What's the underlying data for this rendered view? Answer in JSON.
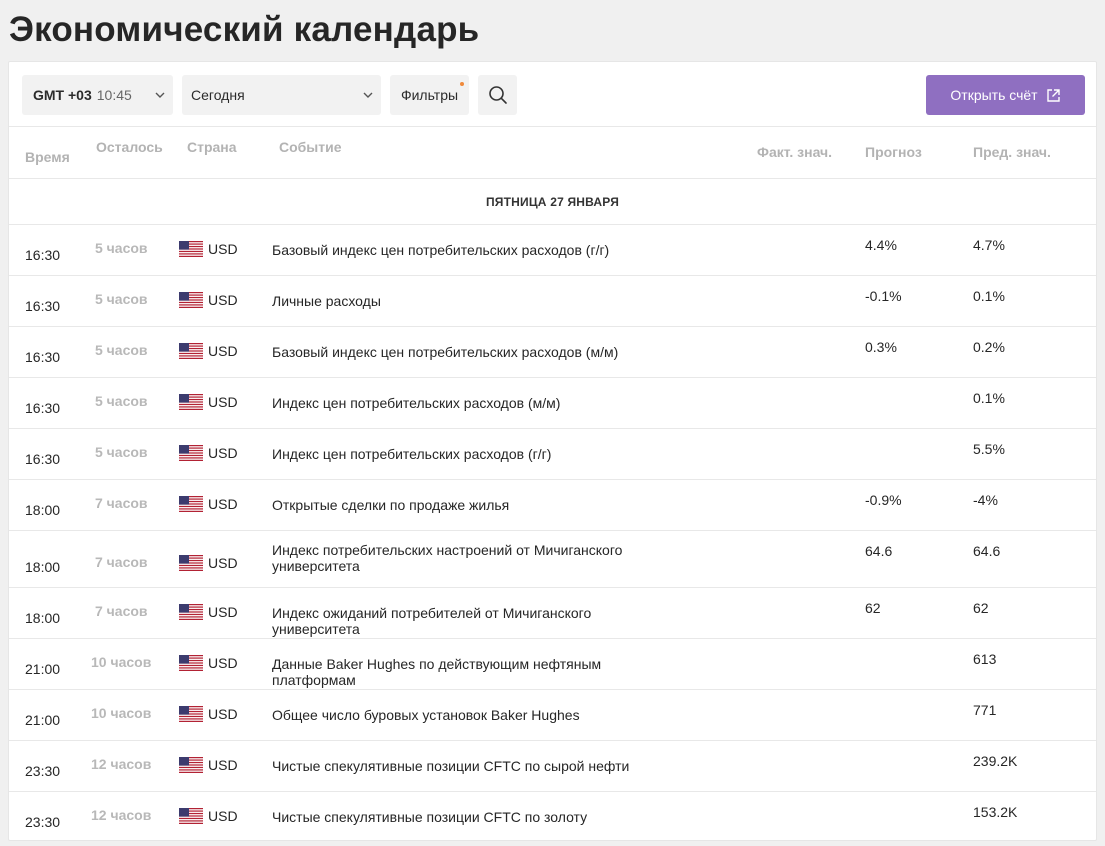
{
  "page_title": "Экономический календарь",
  "toolbar": {
    "timezone_label": "GMT +03",
    "timezone_time": "10:45",
    "date_value": "Сегодня",
    "filters_label": "Фильтры",
    "open_account_label": "Открыть счёт"
  },
  "columns": {
    "time": "Время",
    "remaining": "Осталось",
    "country": "Страна",
    "event": "Событие",
    "actual": "Факт. знач.",
    "forecast": "Прогноз",
    "previous": "Пред. знач."
  },
  "day_header": "ПЯТНИЦА 27 ЯНВАРЯ",
  "events": [
    {
      "time": "16:30",
      "remaining": "5 часов",
      "currency": "USD",
      "event": "Базовый индекс цен потребительских расходов (г/г)",
      "actual": "",
      "forecast": "4.4%",
      "previous": "4.7%"
    },
    {
      "time": "16:30",
      "remaining": "5 часов",
      "currency": "USD",
      "event": "Личные расходы",
      "actual": "",
      "forecast": "-0.1%",
      "previous": "0.1%"
    },
    {
      "time": "16:30",
      "remaining": "5 часов",
      "currency": "USD",
      "event": "Базовый индекс цен потребительских расходов (м/м)",
      "actual": "",
      "forecast": "0.3%",
      "previous": "0.2%"
    },
    {
      "time": "16:30",
      "remaining": "5 часов",
      "currency": "USD",
      "event": "Индекс цен потребительских расходов (м/м)",
      "actual": "",
      "forecast": "",
      "previous": "0.1%"
    },
    {
      "time": "16:30",
      "remaining": "5 часов",
      "currency": "USD",
      "event": "Индекс цен потребительских расходов (г/г)",
      "actual": "",
      "forecast": "",
      "previous": "5.5%"
    },
    {
      "time": "18:00",
      "remaining": "7 часов",
      "currency": "USD",
      "event": "Открытые сделки по продаже жилья",
      "actual": "",
      "forecast": "-0.9%",
      "previous": "-4%"
    },
    {
      "time": "18:00",
      "remaining": "7 часов",
      "currency": "USD",
      "event": "Индекс потребительских настроений от Мичиганского университета",
      "actual": "",
      "forecast": "64.6",
      "previous": "64.6"
    },
    {
      "time": "18:00",
      "remaining": "7 часов",
      "currency": "USD",
      "event": "Индекс ожиданий потребителей от Мичиганского университета",
      "actual": "",
      "forecast": "62",
      "previous": "62"
    },
    {
      "time": "21:00",
      "remaining": "10 часов",
      "currency": "USD",
      "event": "Данные Baker Hughes по действующим нефтяным платформам",
      "actual": "",
      "forecast": "",
      "previous": "613"
    },
    {
      "time": "21:00",
      "remaining": "10 часов",
      "currency": "USD",
      "event": "Общее число буровых установок Baker Hughes",
      "actual": "",
      "forecast": "",
      "previous": "771"
    },
    {
      "time": "23:30",
      "remaining": "12 часов",
      "currency": "USD",
      "event": "Чистые спекулятивные позиции CFTC по сырой нефти",
      "actual": "",
      "forecast": "",
      "previous": "239.2K"
    },
    {
      "time": "23:30",
      "remaining": "12 часов",
      "currency": "USD",
      "event": "Чистые спекулятивные позиции CFTC по золоту",
      "actual": "",
      "forecast": "",
      "previous": "153.2K"
    }
  ],
  "colors": {
    "accent": "#8f6fc1",
    "filter_dot": "#f08a3c",
    "muted": "#b3b3b3"
  }
}
